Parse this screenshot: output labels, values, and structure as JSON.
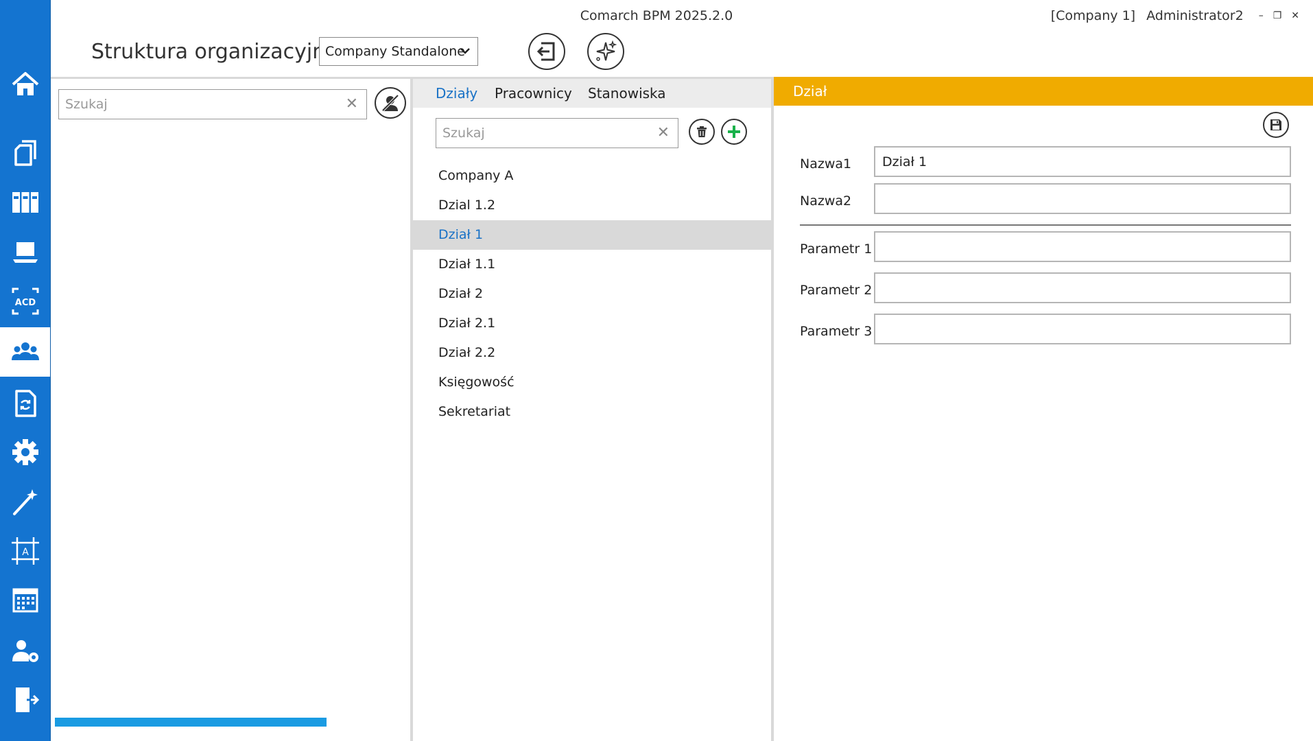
{
  "titlebar": {
    "app_title": "Comarch BPM 2025.2.0",
    "company": "[Company 1]",
    "user": "Administrator2",
    "minimize": "–",
    "restore": "❐",
    "close": "✕"
  },
  "header": {
    "page_title": "Struktura organizacyjna",
    "company_select": "Company Standalone"
  },
  "left_panel": {
    "search_placeholder": "Szukaj",
    "clear": "✕"
  },
  "middle_panel": {
    "tabs": [
      {
        "label": "Działy",
        "active": true
      },
      {
        "label": "Pracownicy",
        "active": false
      },
      {
        "label": "Stanowiska",
        "active": false
      }
    ],
    "search_placeholder": "Szukaj",
    "clear": "✕",
    "items": [
      {
        "label": "Company A",
        "selected": false
      },
      {
        "label": "Dzial 1.2",
        "selected": false
      },
      {
        "label": "Dział 1",
        "selected": true
      },
      {
        "label": "Dział 1.1",
        "selected": false
      },
      {
        "label": "Dział 2",
        "selected": false
      },
      {
        "label": "Dział 2.1",
        "selected": false
      },
      {
        "label": "Dział 2.2",
        "selected": false
      },
      {
        "label": "Księgowość",
        "selected": false
      },
      {
        "label": "Sekretariat",
        "selected": false
      }
    ]
  },
  "right_panel": {
    "section_title": "Dział",
    "fields": {
      "nazwa1_label": "Nazwa1",
      "nazwa1_value": "Dział 1",
      "nazwa2_label": "Nazwa2",
      "nazwa2_value": "",
      "param1_label": "Parametr 1",
      "param1_value": "",
      "param2_label": "Parametr 2",
      "param2_value": "",
      "param3_label": "Parametr 3",
      "param3_value": ""
    }
  },
  "nav": {
    "icons": [
      "home-icon",
      "documents-icon",
      "binders-icon",
      "laptop-icon",
      "acd-icon",
      "users-icon",
      "document-sync-icon",
      "gear-icon",
      "magic-wand-icon",
      "frame-a-icon",
      "calendar-icon",
      "user-settings-icon",
      "exit-door-icon"
    ],
    "active": "users-icon",
    "acd_label": "ACD",
    "frame_label": "A"
  },
  "colors": {
    "nav_blue": "#1474d0",
    "section_header": "#f0ab00",
    "accent_text": "#1a72c6",
    "progress": "#1a9be2"
  }
}
